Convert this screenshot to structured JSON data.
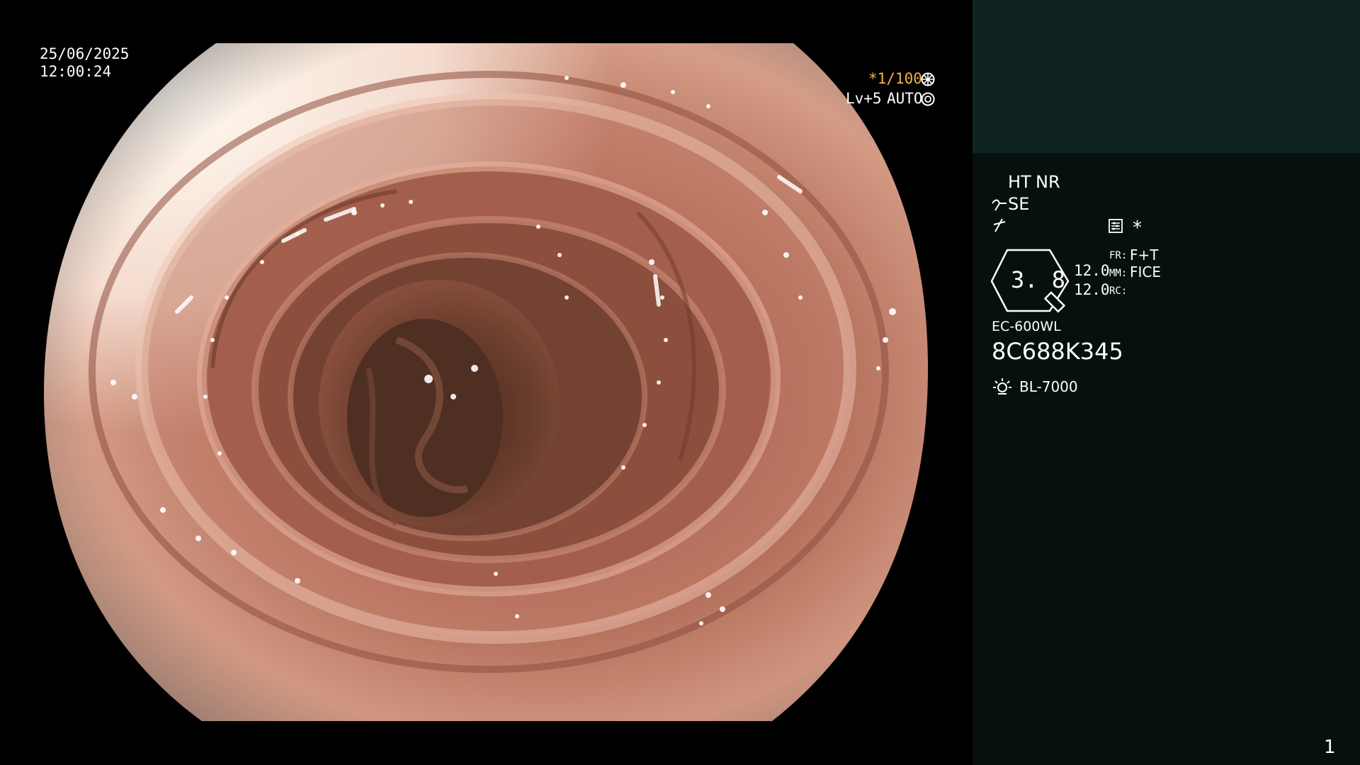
{
  "overlay": {
    "date": "25/06/2025",
    "time": "12:00:24",
    "shutter": "*1/100",
    "level": "Lv+5",
    "iris_mode": "AUTO"
  },
  "panel": {
    "ht_label": "HT",
    "nr_label": "NR",
    "se_label": "SE",
    "star": "*",
    "zoom_value": "3. 8",
    "mm_value_1": "12.0",
    "mm_value_2": "12.0",
    "fr_key": "FR:",
    "fr_value": "F+T",
    "mm_key": "MM:",
    "mm_value": "FICE",
    "rc_key": "RC:",
    "scope_model": "EC-600WL",
    "serial_number": "8C688K345",
    "light_source": "BL-7000",
    "page_number": "1"
  },
  "colors": {
    "panel_background": "#06110f",
    "panel_top": "#0f2421",
    "accent_amber": "#f2b247",
    "mucosa": "#b86c57"
  },
  "icons": [
    "shutter-icon",
    "iris-icon",
    "curve-icon",
    "flat-icon",
    "settings-icon",
    "zoom-icon",
    "light-icon"
  ]
}
